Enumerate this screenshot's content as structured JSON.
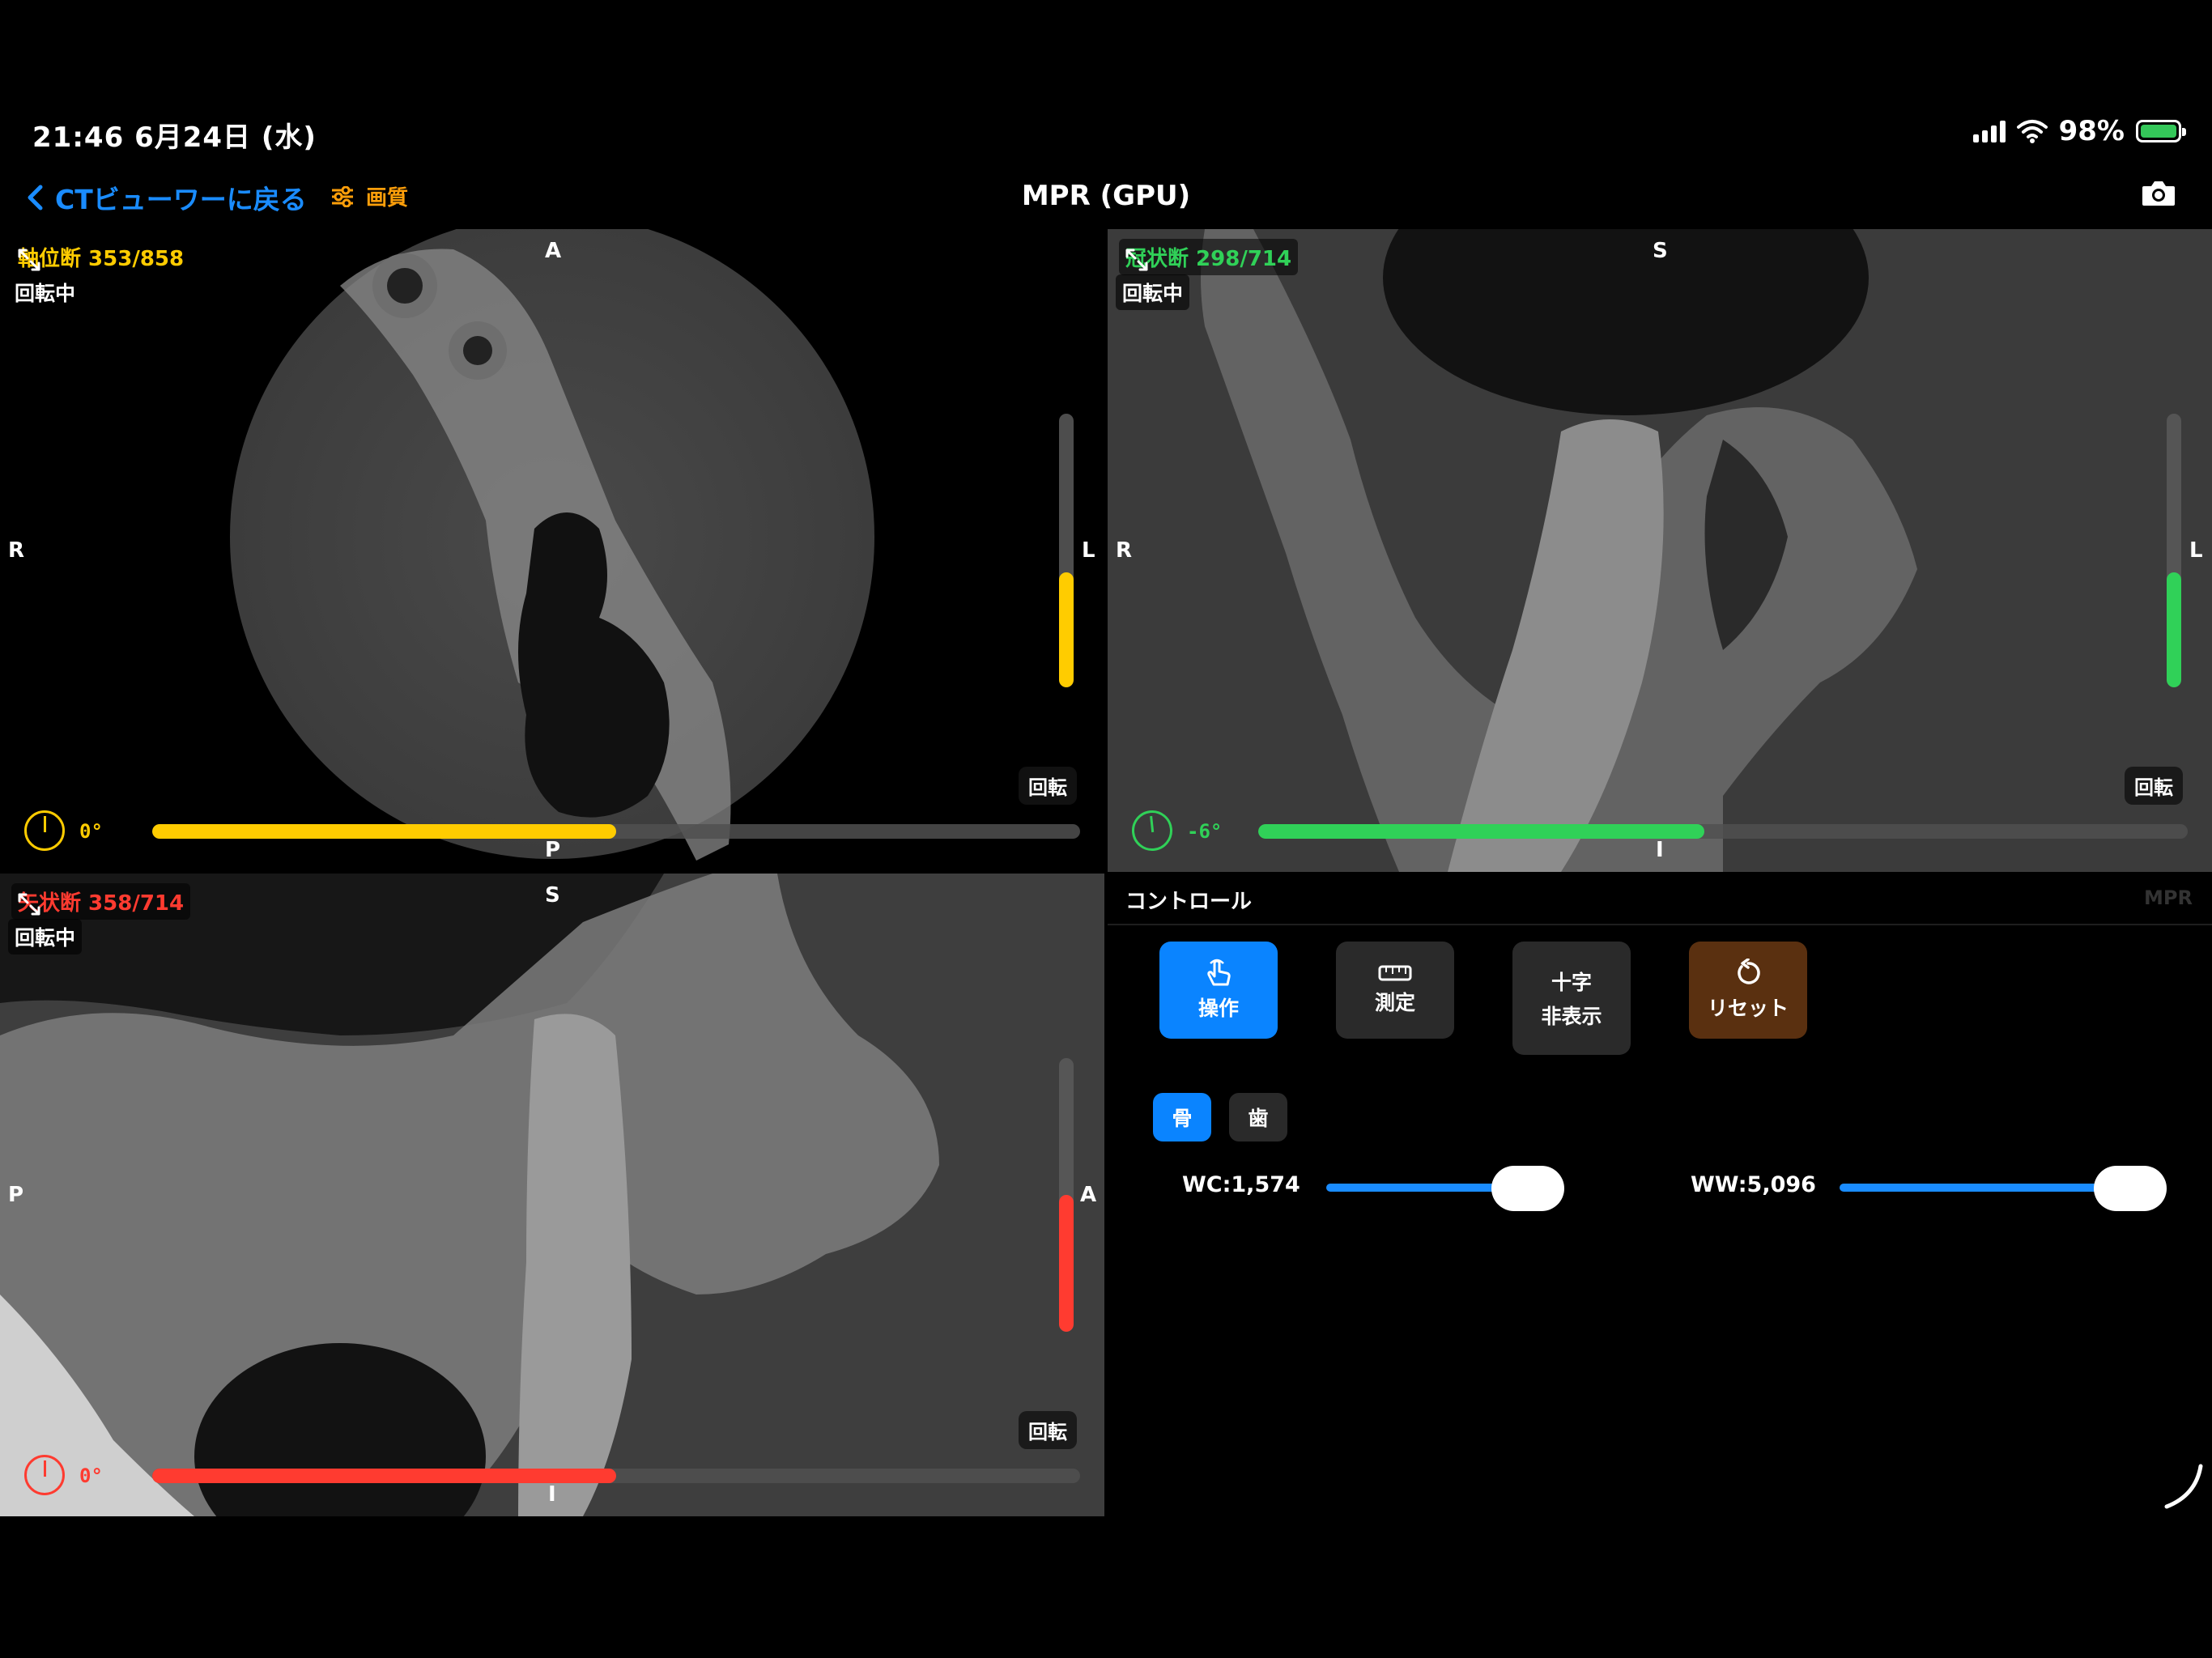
{
  "status_bar": {
    "time_date": "21:46  6月24日 (水)",
    "battery_percent": "98%"
  },
  "nav": {
    "back_label": "CTビューワーに戻る",
    "quality_label": "画質",
    "title": "MPR (GPU)"
  },
  "views": {
    "axial": {
      "slice_label": "軸位断 353/858",
      "rotating_label": "回転中",
      "orient_top": "A",
      "orient_bottom": "P",
      "orient_left": "R",
      "orient_right": "L",
      "rotate_button": "回転",
      "angle": "0°",
      "color": "#ffcc00",
      "slice_progress": 0.5,
      "vertical_level": 0.42
    },
    "coronal": {
      "slice_label": "冠状断 298/714",
      "rotating_label": "回転中",
      "orient_top": "S",
      "orient_bottom": "I",
      "orient_left": "R",
      "orient_right": "L",
      "rotate_button": "回転",
      "angle": "-6°",
      "color": "#30d158",
      "slice_progress": 0.48,
      "vertical_level": 0.42
    },
    "sagittal": {
      "slice_label": "矢状断 358/714",
      "rotating_label": "回転中",
      "orient_top": "S",
      "orient_bottom": "I",
      "orient_left": "P",
      "orient_right": "A",
      "rotate_button": "回転",
      "angle": "0°",
      "color": "#ff3b30",
      "slice_progress": 0.5,
      "vertical_level": 0.5
    }
  },
  "controls": {
    "header": "コントロール",
    "mode_label": "MPR",
    "tools": {
      "operate": "操作",
      "measure": "測定",
      "crosshair_line1": "十字",
      "crosshair_line2": "非表示",
      "reset": "リセット"
    },
    "presets": {
      "bone": "骨",
      "tooth": "歯"
    },
    "wc_label": "WC:1,574",
    "ww_label": "WW:5,096"
  }
}
